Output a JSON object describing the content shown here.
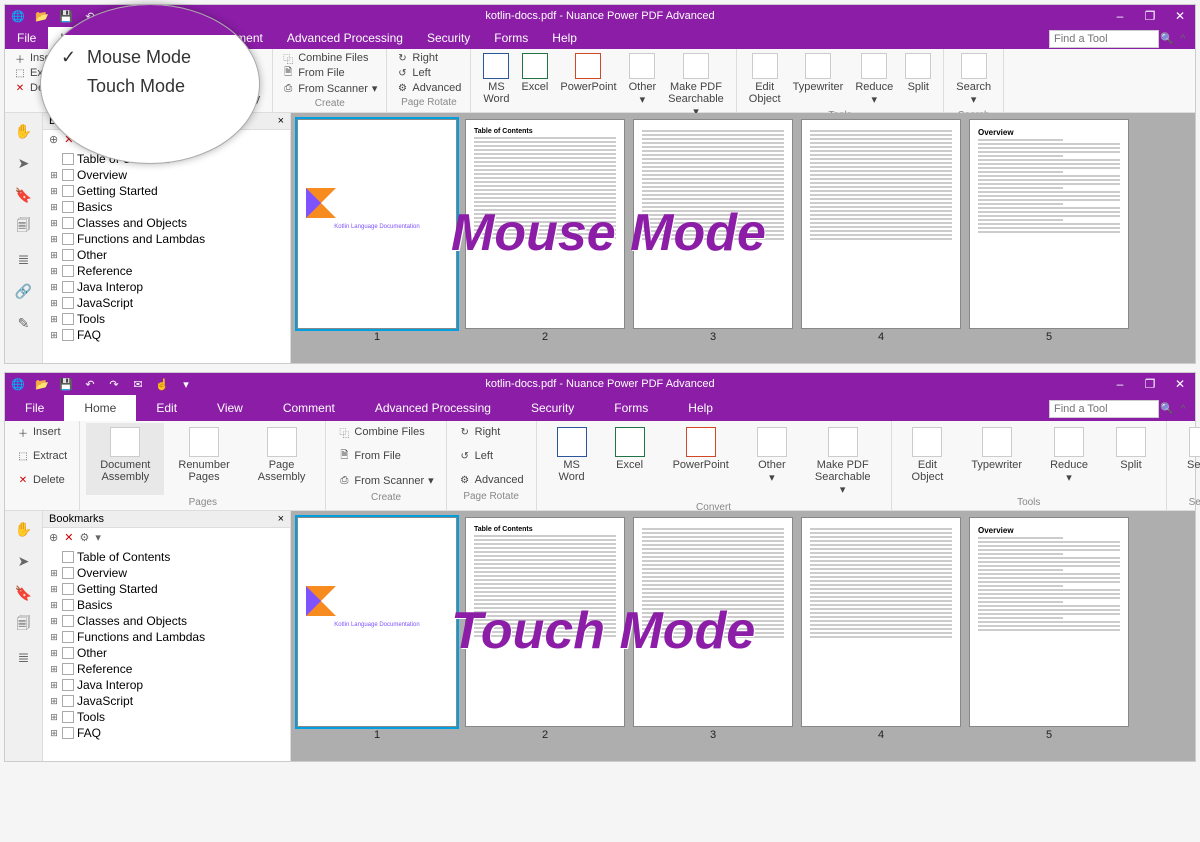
{
  "app_title": "kotlin-docs.pdf - Nuance Power PDF Advanced",
  "find_placeholder": "Find a Tool",
  "menus": [
    "File",
    "Home",
    "Edit",
    "View",
    "Comment",
    "Advanced Processing",
    "Security",
    "Forms",
    "Help"
  ],
  "active_menu": "Home",
  "zoom_popup": {
    "mouse": "Mouse Mode",
    "touch": "Touch Mode"
  },
  "overlay": {
    "mouse": "Mouse Mode",
    "touch": "Touch Mode"
  },
  "ribbon_pages": {
    "insert": "Insert",
    "extract": "Extract",
    "delete": "Delete",
    "doc_assembly": "Document\nAssembly",
    "renumber": "Renumber\nPages",
    "page_assembly": "Page\nAssembly",
    "label": "Pages"
  },
  "ribbon_create": {
    "combine": "Combine Files",
    "fromfile": "From File",
    "fromscan": "From Scanner",
    "label": "Create"
  },
  "ribbon_rotate": {
    "right": "Right",
    "left": "Left",
    "adv": "Advanced",
    "label": "Page Rotate"
  },
  "ribbon_convert": {
    "word": "MS\nWord",
    "excel": "Excel",
    "ppt": "PowerPoint",
    "other": "Other",
    "searchable": "Make PDF\nSearchable",
    "label": "Convert"
  },
  "ribbon_tools": {
    "editobj": "Edit\nObject",
    "type": "Typewriter",
    "reduce": "Reduce",
    "split": "Split",
    "label": "Tools"
  },
  "ribbon_search": {
    "search": "Search",
    "label": "Search"
  },
  "bookmarks_title": "Bookmarks",
  "bookmarks": [
    "Table of Contents",
    "Overview",
    "Getting Started",
    "Basics",
    "Classes and Objects",
    "Functions and Lambdas",
    "Other",
    "Reference",
    "Java Interop",
    "JavaScript",
    "Tools",
    "FAQ"
  ],
  "thumb_title": "Table of Contents",
  "thumb_ov": "Overview",
  "page1_sub": "Kotlin Language Documentation",
  "page_nums": [
    "1",
    "2",
    "3",
    "4",
    "5"
  ]
}
